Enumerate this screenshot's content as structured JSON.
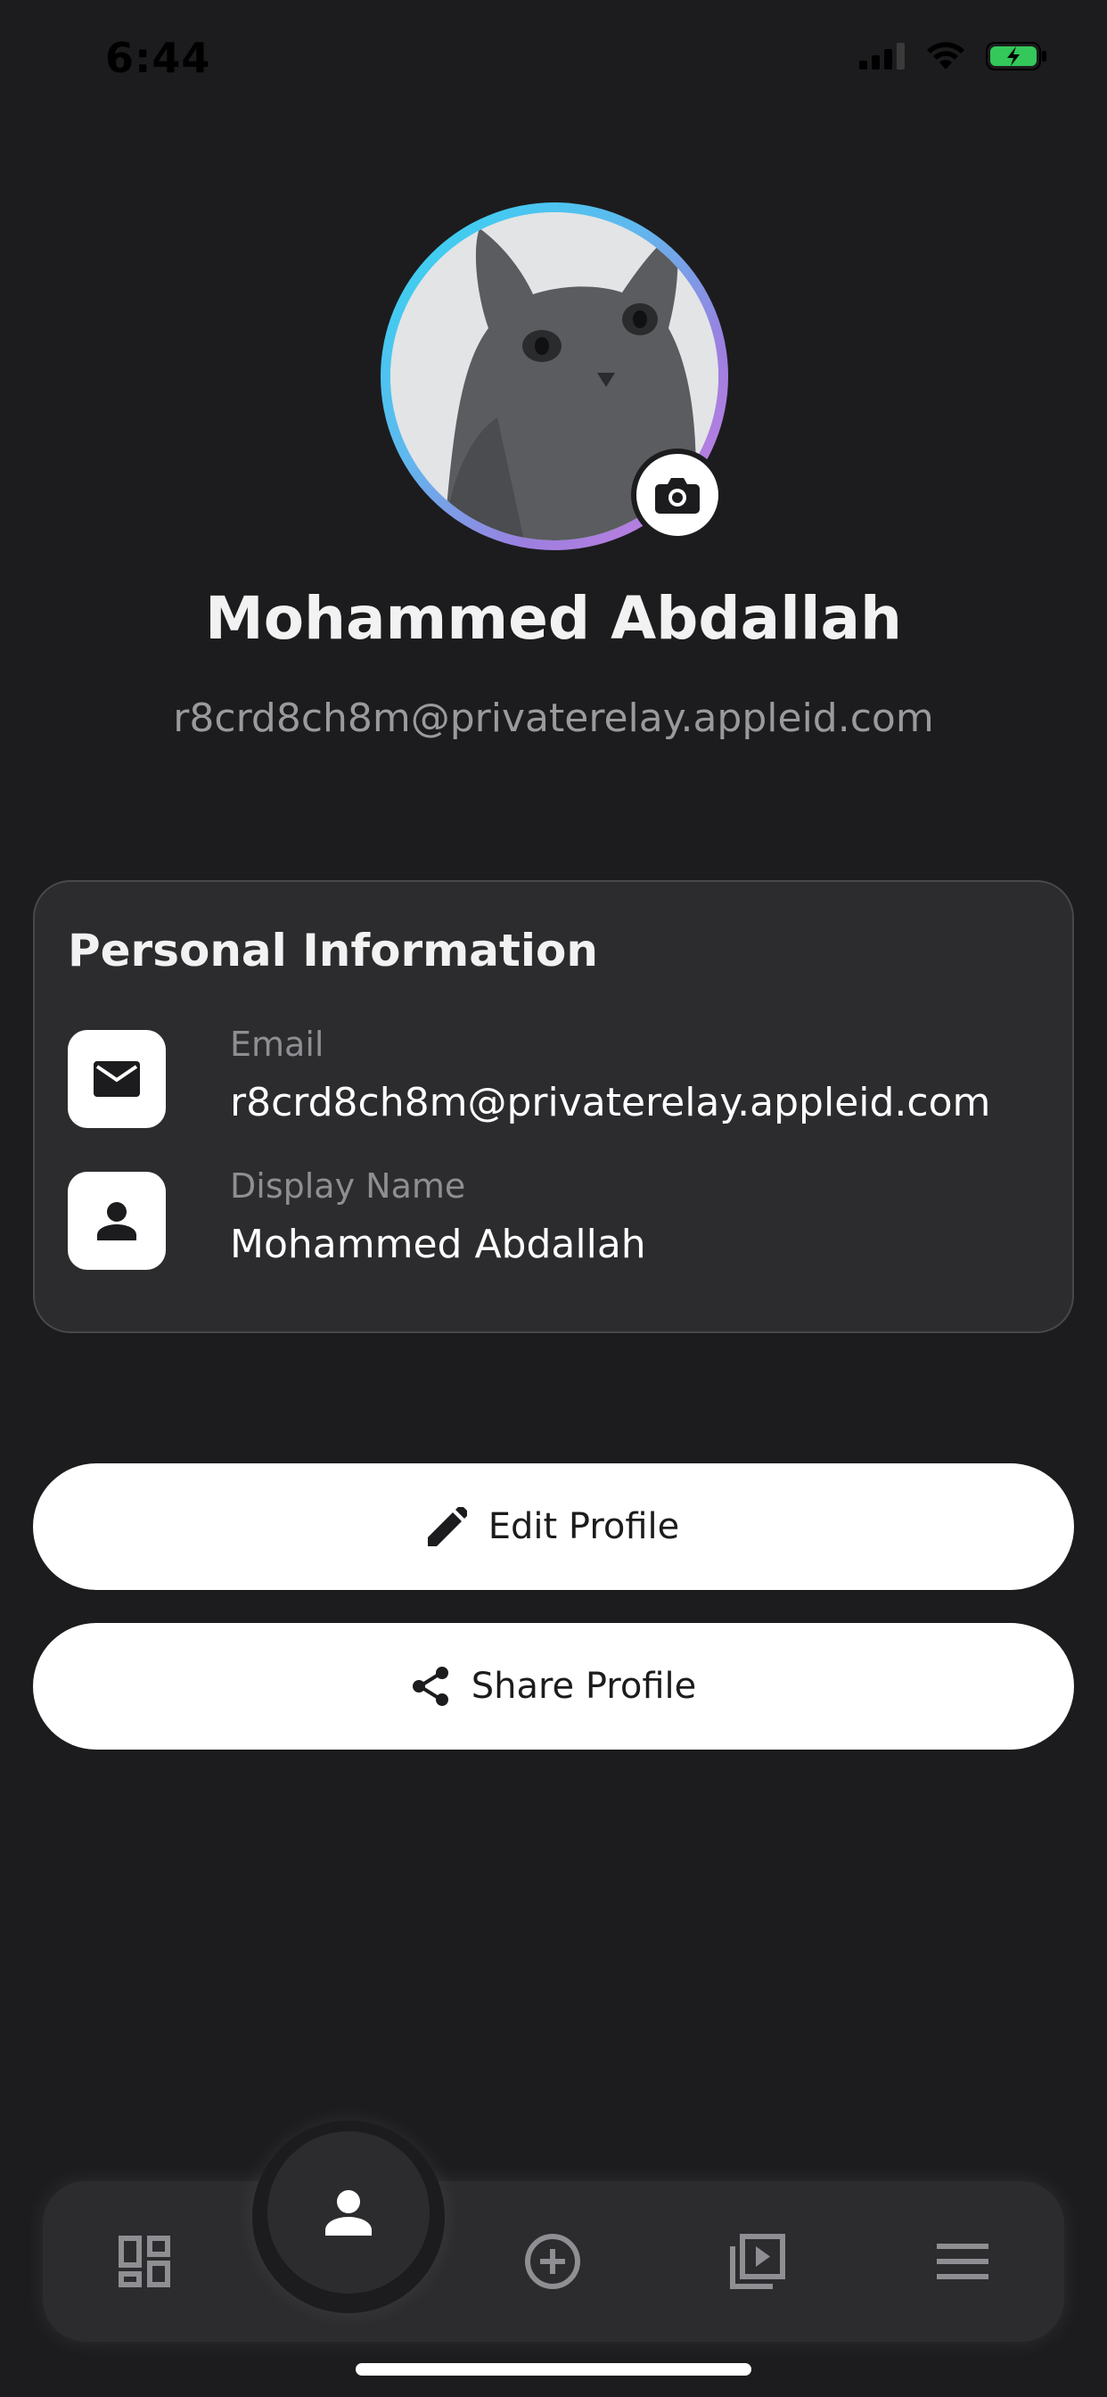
{
  "status_bar": {
    "time": "6:44"
  },
  "profile": {
    "name": "Mohammed Abdallah",
    "email": "r8crd8ch8m@privaterelay.appleid.com",
    "avatar_icon": "cat-photo",
    "camera_icon": "camera-icon"
  },
  "personal_info": {
    "title": "Personal Information",
    "rows": [
      {
        "icon": "mail-icon",
        "label": "Email",
        "value": "r8crd8ch8m@privaterelay.appleid.com"
      },
      {
        "icon": "person-icon",
        "label": "Display Name",
        "value": "Mohammed Abdallah"
      }
    ]
  },
  "actions": {
    "edit_label": "Edit Profile",
    "share_label": "Share Profile"
  },
  "tab_bar": {
    "items": [
      "dashboard-icon",
      "profile-icon",
      "add-circle-icon",
      "video-library-icon",
      "menu-icon"
    ],
    "active": "profile-icon"
  },
  "colors": {
    "background": "#1c1c1e",
    "card": "#2c2c2e",
    "ring_start": "#2fd8f2",
    "ring_end": "#d07ee0",
    "battery": "#34c759"
  }
}
